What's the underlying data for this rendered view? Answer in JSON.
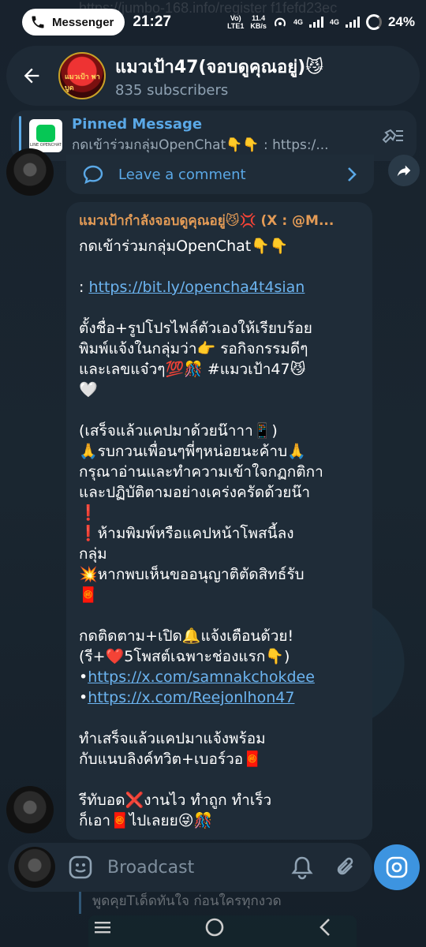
{
  "status_bar": {
    "app_pill": "Messenger",
    "time": "21:27",
    "volte": "Vo)\nLTE1",
    "net_speed_value": "11.4",
    "net_speed_unit": "KB/s",
    "network_1": "4G",
    "network_2": "4G",
    "battery": "24%",
    "background_url": "https://jumbo-168.info/register f1fefd23ec"
  },
  "header": {
    "title": "แมวเป้า47(จอบดูคุณอยู่)😼",
    "subscribers": "835 subscribers",
    "avatar_text": "แมวเป้า พาบูด"
  },
  "pinned": {
    "title": "Pinned Message",
    "preview": "กดเข้าร่วมกลุ่มOpenChat👇👇   : https:/...",
    "thumb_text": "LINE OPENCHAT"
  },
  "previous_message": {
    "comment_label": "Leave a comment"
  },
  "message": {
    "forwarded_from": "แมวเป้ากำลังจอบดูคุณอยู่😼💢 (X : @M...",
    "lines": [
      {
        "text": "กดเข้าร่วมกลุ่มOpenChat👇👇"
      },
      {
        "text": ""
      },
      {
        "prefix": ": ",
        "link": "https://bit.ly/opencha4t4sian"
      },
      {
        "text": ""
      },
      {
        "text": "ตั้งชื่อ+รูปโปรไฟล์ตัวเองให้เรียบร้อย"
      },
      {
        "text": "พิมพ์แจ้งในกลุ่มว่า👉 รอกิจกรรมดีๆ"
      },
      {
        "text": "และเลขแจ๋วๆ💯🎊 #แมวเป้า47😼"
      },
      {
        "text": "🤍"
      },
      {
        "text": ""
      },
      {
        "text": "(เสร็จแล้วแคปมาด้วยน๊าาา📱)"
      },
      {
        "text": "🙏รบกวนเพื่อนๆพี่ๆหน่อยนะค้าบ🙏"
      },
      {
        "text": "กรุณาอ่านและทำความเข้าใจกฏกติกา"
      },
      {
        "text": "และปฏิบัติตามอย่างเคร่งครัดด้วยน๊า"
      },
      {
        "text": "❗"
      },
      {
        "text": "❗ห้ามพิมพ์หรือแคปหน้าโพสนี้ลง"
      },
      {
        "text": "กลุ่ม"
      },
      {
        "text": "💥หากพบเห็นขออนุญาติตัดสิทธ์รับ"
      },
      {
        "text": "🧧"
      },
      {
        "text": ""
      },
      {
        "text": "กดติดตาม+เปิด🔔แจ้งเตือนด้วย!"
      },
      {
        "text": "(รี+❤️5โพสต์เฉพาะช่องแรก👇)"
      },
      {
        "prefix": "•",
        "link": "https://x.com/samnakchokdee"
      },
      {
        "prefix": "•",
        "link": "https://x.com/Reejonlhon47"
      },
      {
        "text": ""
      },
      {
        "text": "ทำเสร็จแล้วแคปมาแจ้งพร้อม"
      },
      {
        "text": "กับแนบลิงค์ทวิต+เบอร์วอ🧧"
      },
      {
        "text": ""
      },
      {
        "text": "รีทับอด❌งานไว ทำถูก ทำเร็ว"
      },
      {
        "text": "ก็เอา🧧ไปเลยย😜🎊"
      }
    ]
  },
  "input_bar": {
    "placeholder": "Broadcast",
    "below_preview": "พูดคุยTเด็ดทันใจ ก่อนใครทุกงวด"
  },
  "icons": {
    "back": "back-arrow-icon",
    "share": "share-arrow-icon",
    "comment": "comment-bubble-icon",
    "chevron": "chevron-right-icon",
    "pin_list": "pin-list-icon",
    "emoji": "sticker-icon",
    "bell": "bell-icon",
    "attach": "paperclip-icon",
    "camera": "camera-icon"
  },
  "colors": {
    "accent": "#5aa8e6",
    "forward_name": "#e39b56",
    "bubble": "#1f2c38",
    "camera_button": "#3d94e0"
  }
}
